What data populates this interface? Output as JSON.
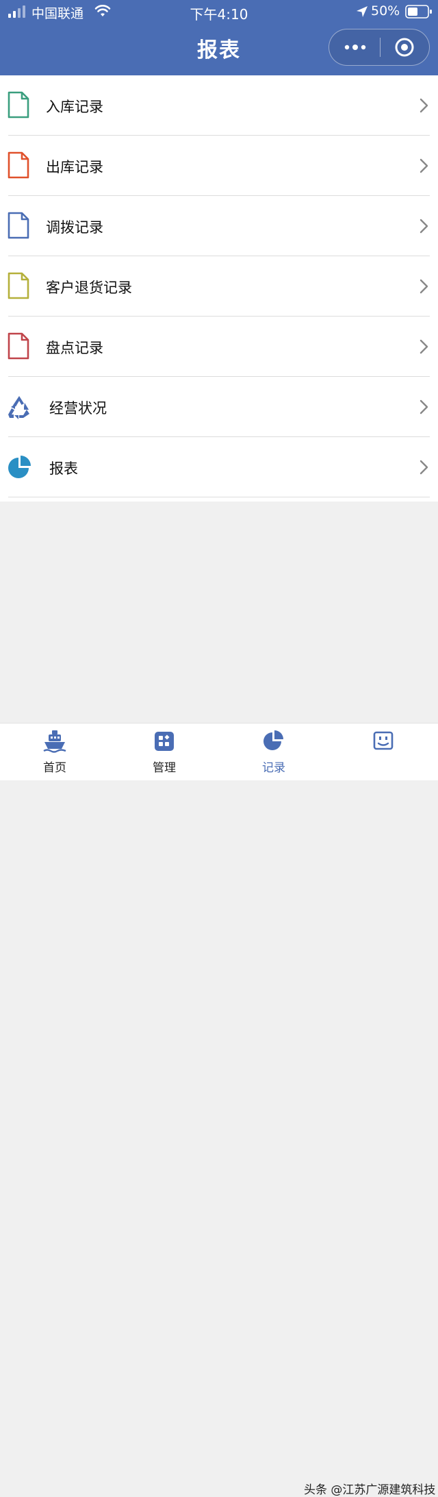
{
  "status_bar": {
    "carrier": "中国联通",
    "time": "下午4:10",
    "battery": "50%"
  },
  "header": {
    "title": "报表"
  },
  "menu": [
    {
      "label": "入库记录",
      "icon": "document-icon",
      "color": "#3a9e7e"
    },
    {
      "label": "出库记录",
      "icon": "document-icon",
      "color": "#e0512b"
    },
    {
      "label": "调拨记录",
      "icon": "document-icon",
      "color": "#4a6db4"
    },
    {
      "label": "客户退货记录",
      "icon": "document-icon",
      "color": "#b5b03a"
    },
    {
      "label": "盘点记录",
      "icon": "document-icon",
      "color": "#c0444a"
    },
    {
      "label": "经营状况",
      "icon": "recycle-icon",
      "color": "#4a6db4"
    },
    {
      "label": "报表",
      "icon": "pie-chart-icon",
      "color": "#2a8fc4"
    }
  ],
  "tabbar": {
    "items": [
      {
        "label": "首页",
        "icon": "ship-icon"
      },
      {
        "label": "管理",
        "icon": "grid-icon"
      },
      {
        "label": "记录",
        "icon": "pie-chart-icon",
        "active": true
      },
      {
        "label": "",
        "icon": "smiley-box-icon"
      }
    ]
  },
  "watermark": "头条 @江苏广源建筑科技",
  "colors": {
    "header": "#4a6db4",
    "active_tab": "#4a6db4"
  }
}
